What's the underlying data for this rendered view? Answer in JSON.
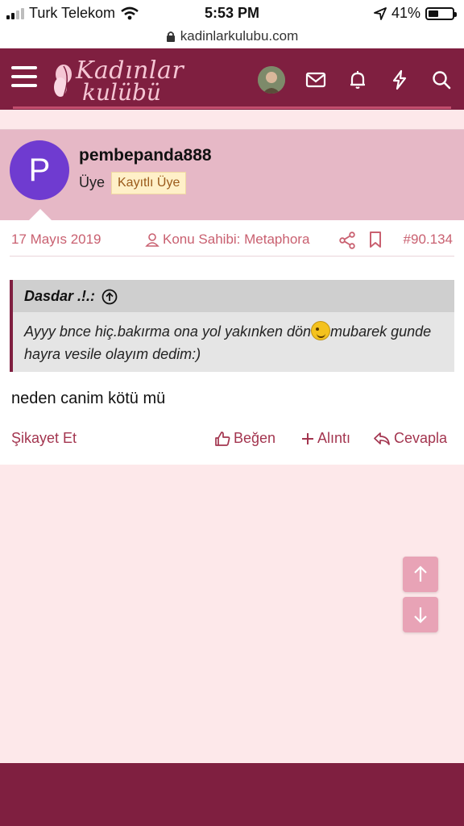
{
  "status_bar": {
    "carrier": "Turk Telekom",
    "time": "5:53 PM",
    "battery": "41%"
  },
  "url_bar": {
    "domain": "kadinlarkulubu.com"
  },
  "header": {
    "logo_line1": "Kadınlar",
    "logo_line2": "kulübü"
  },
  "post": {
    "avatar_letter": "P",
    "username": "pembepanda888",
    "user_title": "Üye",
    "badge": "Kayıtlı Üye",
    "date": "17 Mayıs 2019",
    "thread_starter": "Konu Sahibi: Metaphora",
    "post_number": "#90.134",
    "quote": {
      "author": "Dasdar .!.:",
      "text_part1": "Ayyy bnce hiç.bakırma ona yol yakınken dön",
      "text_part2": "mubarek gunde hayra vesile olayım dedim:)"
    },
    "message": "neden canim kötü mü",
    "actions": {
      "report": "Şikayet Et",
      "like": "Beğen",
      "quote": "Alıntı",
      "reply": "Cevapla"
    }
  },
  "colors": {
    "brand": "#7f1f40",
    "post_header_bg": "#e6b8c6",
    "page_bg": "#fde8ea",
    "accent_text": "#c96070"
  }
}
